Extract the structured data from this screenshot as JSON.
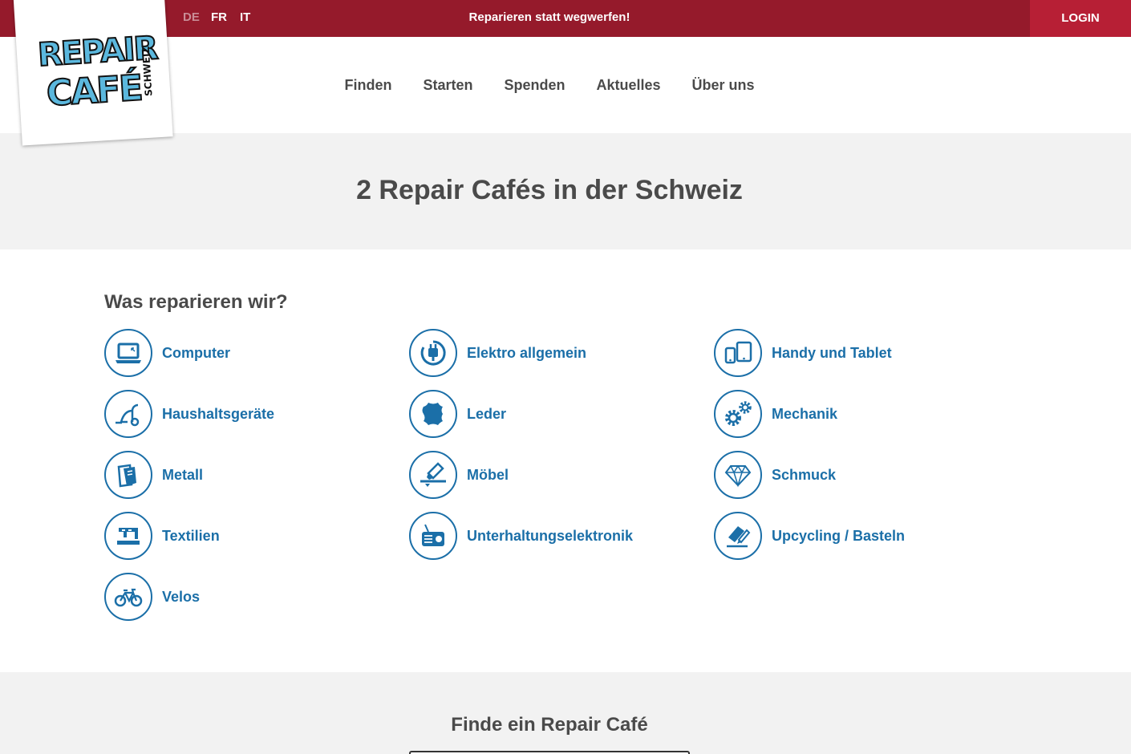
{
  "topbar": {
    "languages": [
      "DE",
      "FR",
      "IT"
    ],
    "active_language": "DE",
    "slogan": "Reparieren statt wegwerfen!",
    "login_label": "LOGIN"
  },
  "logo": {
    "line1": "REPAIR",
    "line2": "CAFÉ",
    "side": "SCHWEIZ"
  },
  "nav": {
    "items": [
      "Finden",
      "Starten",
      "Spenden",
      "Aktuelles",
      "Über uns"
    ]
  },
  "hero": {
    "title": "2 Repair Cafés in der Schweiz"
  },
  "categories": {
    "title": "Was reparieren wir?",
    "items": [
      {
        "label": "Computer",
        "icon": "laptop-icon"
      },
      {
        "label": "Elektro allgemein",
        "icon": "plug-icon"
      },
      {
        "label": "Handy und Tablet",
        "icon": "phone-tablet-icon"
      },
      {
        "label": "Haushaltsgeräte",
        "icon": "vacuum-icon"
      },
      {
        "label": "Leder",
        "icon": "leather-icon"
      },
      {
        "label": "Mechanik",
        "icon": "gears-icon"
      },
      {
        "label": "Metall",
        "icon": "metal-icon"
      },
      {
        "label": "Möbel",
        "icon": "furniture-icon"
      },
      {
        "label": "Schmuck",
        "icon": "diamond-icon"
      },
      {
        "label": "Textilien",
        "icon": "sewing-machine-icon"
      },
      {
        "label": "Unterhaltungselektronik",
        "icon": "radio-icon"
      },
      {
        "label": "Upcycling / Basteln",
        "icon": "crafting-icon"
      },
      {
        "label": "Velos",
        "icon": "bicycle-icon"
      }
    ]
  },
  "finder": {
    "title": "Finde ein Repair Café"
  },
  "colors": {
    "topbar": "#951a2b",
    "login": "#b71f35",
    "accent_blue": "#1b6fa8",
    "text": "#4a4a4a",
    "gray_bg": "#f2f2f2"
  }
}
